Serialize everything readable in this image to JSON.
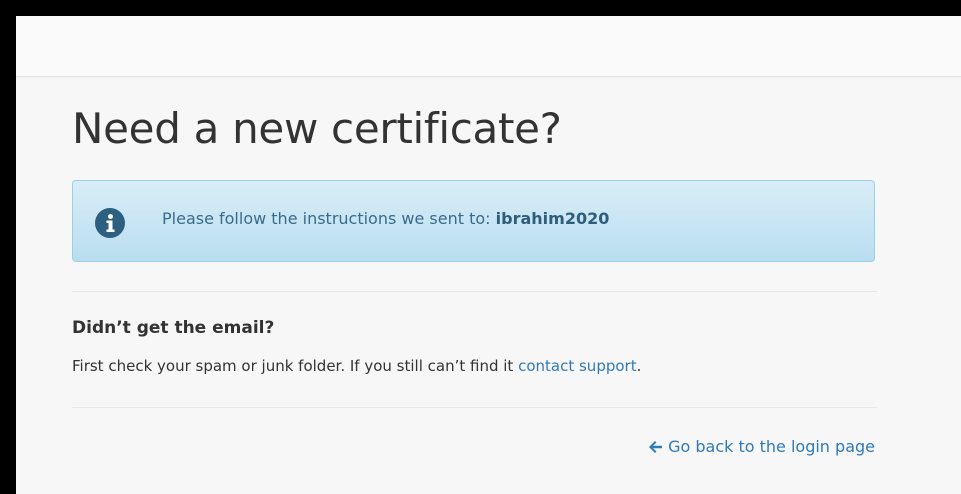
{
  "page": {
    "title": "Need a new certificate?"
  },
  "alert": {
    "message": "Please follow the instructions we sent to:",
    "recipient": "ibrahim2020",
    "icon": "info-circle-icon"
  },
  "help": {
    "heading": "Didn’t get the email?",
    "text": "First check your spam or junk folder. If you still can’t find it",
    "link_label": "contact support",
    "trailing": "."
  },
  "navigation": {
    "back_label": "Go back to the login page",
    "back_icon": "arrow-left-icon"
  },
  "colors": {
    "alert_background": "#c6e6f5",
    "link": "#2f7ab8",
    "icon": "#2c5f80"
  }
}
